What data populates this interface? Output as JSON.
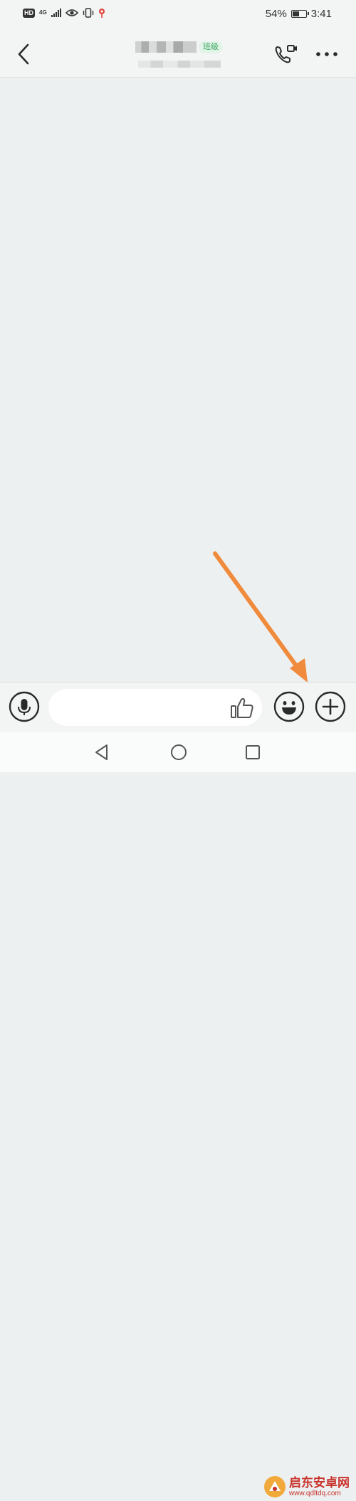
{
  "status_bar": {
    "hd": "HD",
    "network": "4G",
    "battery_percent": "54%",
    "battery_level": 0.54,
    "time": "3:41"
  },
  "header": {
    "badge": "班级",
    "back_icon": "chevron-left-icon",
    "call_icon": "video-call-icon",
    "more_icon": "more-dots-icon"
  },
  "input_bar": {
    "placeholder": "",
    "voice_icon": "microphone-icon",
    "like_icon": "thumbs-up-icon",
    "emoji_icon": "emoji-icon",
    "plus_icon": "plus-icon"
  },
  "watermark": {
    "name": "启东安卓网",
    "url": "www.qdltdq.com"
  },
  "colors": {
    "background": "#edf0f0",
    "badge_green": "#36a65c",
    "annotation_arrow": "#f08a3c",
    "watermark_red": "#c8322b"
  }
}
